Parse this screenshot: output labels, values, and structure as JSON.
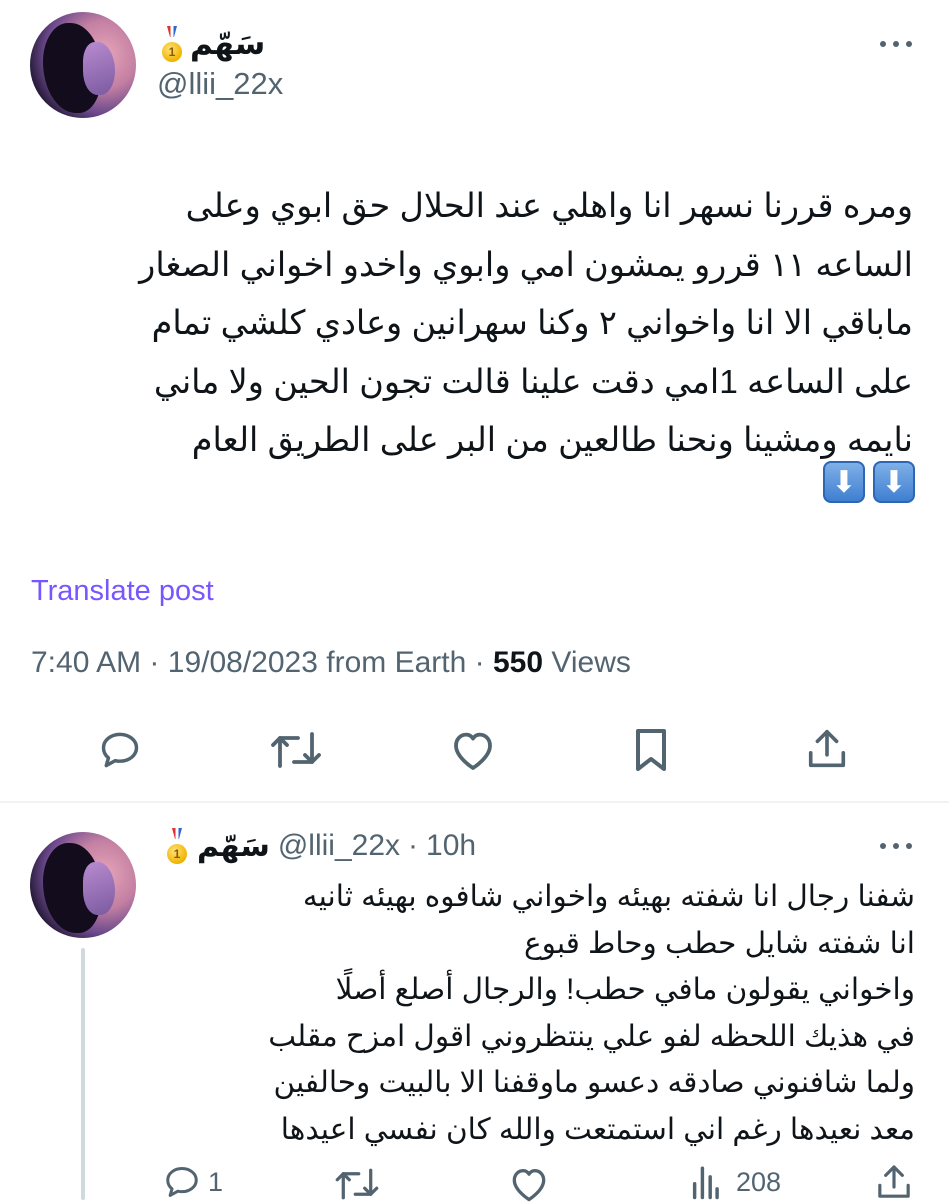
{
  "main_post": {
    "display_name": "سَهّم",
    "handle": "@llii_22x",
    "badge_number": "1",
    "text": "ومره قررنا نسهر انا واهلي عند الحلال حق ابوي وعلى\nالساعه ١١ قررو يمشون امي وابوي واخدو اخواني الصغار\nماباقي الا انا واخواني ٢  وكنا سهرانين وعادي كلشي تمام\nعلى الساعه 1امي دقت علينا قالت تجون الحين ولا ماني\nنايمه ومشينا ونحنا طالعين من البر على الطريق العام",
    "emoji": "⬇️⬇️",
    "translate_label": "Translate post",
    "time": "7:40 AM",
    "date": "19/08/2023",
    "source": "from Earth",
    "views_count": "550",
    "views_label": "Views",
    "sep": "·"
  },
  "reply_post": {
    "display_name": "سَهّم",
    "handle": "@llii_22x",
    "badge_number": "1",
    "age": "10h",
    "sep": "·",
    "text": "شفنا رجال انا شفته بهيئه واخواني شافوه بهيئه ثانيه\nانا شفته شايل حطب وحاط قبوع\nواخواني يقولون مافي حطب! والرجال أصلع أصلًا\nفي هذيك اللحظه لفو علي ينتظروني اقول امزح مقلب\nولما شافنوني صادقه دعسو ماوقفنا الا بالبيت وحالفين\nمعد نعيدها رغم اني استمتعت والله كان نفسي اعيدها",
    "replies_count": "1",
    "views_count": "208"
  },
  "colors": {
    "accent": "#7856ff",
    "muted": "#536471",
    "icon": "#536471",
    "divider": "#eff3f4",
    "thread_line": "#cfd9de"
  }
}
